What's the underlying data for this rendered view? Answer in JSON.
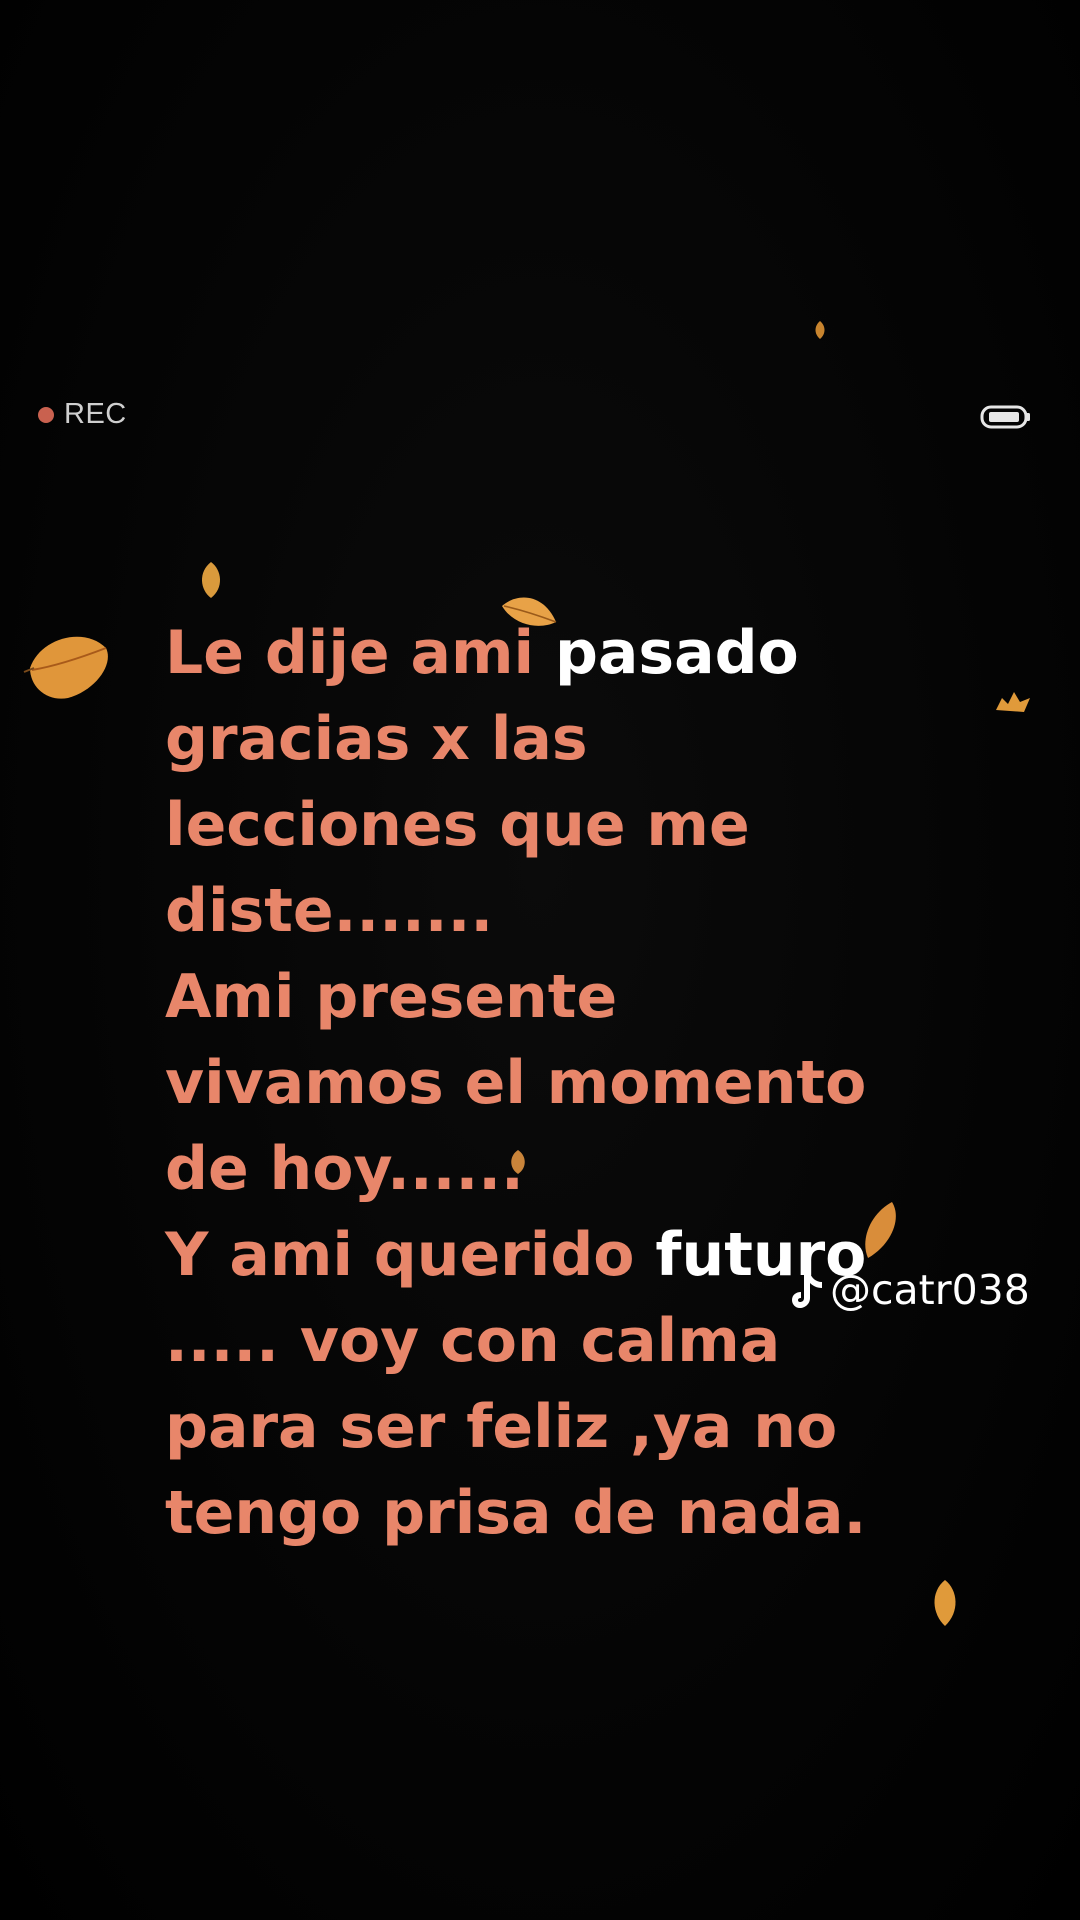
{
  "overlay": {
    "rec_label": "REC",
    "rec_dot_color": "#c9614f",
    "battery_icon": "battery-icon"
  },
  "caption": {
    "color": "#e8866a",
    "highlight_color": "#ffffff",
    "lines": [
      {
        "text": "Le dije ami ",
        "highlight": "pasado"
      },
      {
        "text": "gracias x las"
      },
      {
        "text": "lecciones que me"
      },
      {
        "text": "diste......."
      },
      {
        "text": "Ami presente"
      },
      {
        "text": "vivamos el momento"
      },
      {
        "text": "de hoy......"
      },
      {
        "text": "Y ami querido ",
        "highlight": "futuro"
      },
      {
        "text": "..... voy con calma"
      },
      {
        "text": "para ser feliz ,ya no"
      },
      {
        "text": "tengo prisa de nada."
      }
    ]
  },
  "watermark": {
    "icon": "tiktok-icon",
    "handle": "@catr038"
  },
  "decorations": {
    "leaf_icon": "falling-leaf-icon",
    "leaf_color": "#e09a3a"
  }
}
